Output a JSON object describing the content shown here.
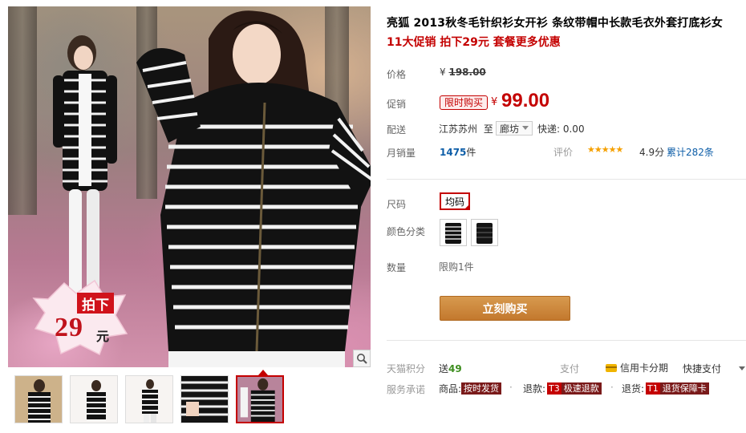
{
  "product": {
    "title": "亮狐 2013秋冬毛针织衫女开衫 条纹带帽中长款毛衣外套打底衫女",
    "subtitle": "11大促销 拍下29元 套餐更多优惠"
  },
  "gallery": {
    "promo_label": "拍下",
    "promo_price": "29",
    "promo_unit": "元",
    "thumb_count": 5,
    "active_thumb": 5
  },
  "price": {
    "label": "价格",
    "currency": "¥",
    "original": "198.00"
  },
  "promotion": {
    "label": "促销",
    "tag": "限时购买",
    "currency": "¥",
    "price": "99.00"
  },
  "shipping": {
    "label": "配送",
    "from": "江苏苏州",
    "to_word": "至",
    "destination": "廊坊",
    "fee": "快递: 0.00"
  },
  "sales": {
    "label": "月销量",
    "count": "1475",
    "unit": "件",
    "rating_label": "评价",
    "stars": "★★★★★",
    "score": "4.9分",
    "reviews": "累计282条"
  },
  "options": {
    "size_label": "尺码",
    "size_value": "均码",
    "color_label": "颜色分类",
    "quantity_label": "数量",
    "limit": "限购1件"
  },
  "actions": {
    "buy": "立刻购买"
  },
  "footer": {
    "points_label": "天猫积分",
    "points_prefix": "送",
    "points_value": "49",
    "pay_label": "支付",
    "credit": "信用卡分期",
    "quick_pay": "快捷支付",
    "service_label": "服务承诺",
    "svc_goods": "商品:",
    "svc_goods_tag": "按时发货",
    "svc_refund": "退款:",
    "svc_refund_code": "T3",
    "svc_refund_tag": "极速退款",
    "svc_return": "退货:",
    "svc_return_code": "T1",
    "svc_return_tag": "退货保障卡"
  },
  "colors": {
    "accent": "#c40000",
    "buy_button": "#c98334",
    "link": "#0e5ea8",
    "star": "#f5a000"
  }
}
